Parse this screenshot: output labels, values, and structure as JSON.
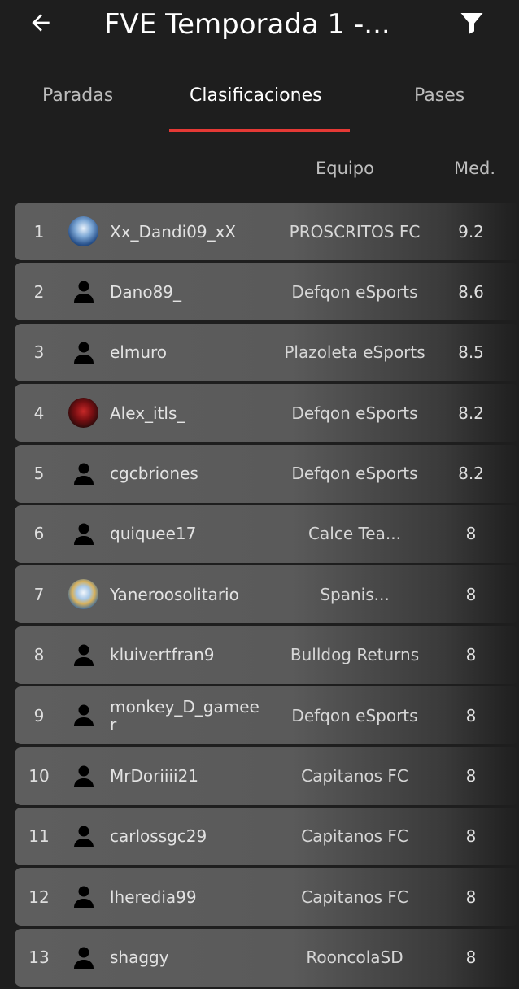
{
  "header": {
    "title": "FVE Temporada 1 -...",
    "back_icon": "arrow-left-icon",
    "filter_icon": "filter-icon"
  },
  "tabs": [
    {
      "label": "Paradas"
    },
    {
      "label": "Clasificaciones",
      "active": true
    },
    {
      "label": "Pases"
    }
  ],
  "columns": {
    "team": "Equipo",
    "avg": "Med."
  },
  "accent_color": "#e53935",
  "rows": [
    {
      "rank": "1",
      "name": "Xx_Dandi09_xX",
      "team": "PROSCRITOS FC",
      "avg": "9.2",
      "avatar": "photo"
    },
    {
      "rank": "2",
      "name": "Dano89_",
      "team": "Defqon eSports",
      "avg": "8.6",
      "avatar": "person"
    },
    {
      "rank": "3",
      "name": "elmuro",
      "team": "Plazoleta eSports",
      "avg": "8.5",
      "avatar": "person"
    },
    {
      "rank": "4",
      "name": "Alex_itls_",
      "team": "Defqon eSports",
      "avg": "8.2",
      "avatar": "photo"
    },
    {
      "rank": "5",
      "name": "cgcbriones",
      "team": "Defqon eSports",
      "avg": "8.2",
      "avatar": "person"
    },
    {
      "rank": "6",
      "name": "quiquee17",
      "team": "Calce Tea...",
      "avg": "8",
      "avatar": "person"
    },
    {
      "rank": "7",
      "name": "Yaneroosolitario",
      "team": "Spanis...",
      "avg": "8",
      "avatar": "photo"
    },
    {
      "rank": "8",
      "name": "kluivertfran9",
      "team": "Bulldog Returns",
      "avg": "8",
      "avatar": "person"
    },
    {
      "rank": "9",
      "name": "monkey_D_gameer",
      "team": "Defqon eSports",
      "avg": "8",
      "avatar": "person"
    },
    {
      "rank": "10",
      "name": "MrDoriiii21",
      "team": "Capitanos FC",
      "avg": "8",
      "avatar": "person"
    },
    {
      "rank": "11",
      "name": "carlossgc29",
      "team": "Capitanos FC",
      "avg": "8",
      "avatar": "person"
    },
    {
      "rank": "12",
      "name": "lheredia99",
      "team": "Capitanos FC",
      "avg": "8",
      "avatar": "person"
    },
    {
      "rank": "13",
      "name": "shaggy",
      "team": "RooncolaSD",
      "avg": "8",
      "avatar": "person"
    }
  ]
}
